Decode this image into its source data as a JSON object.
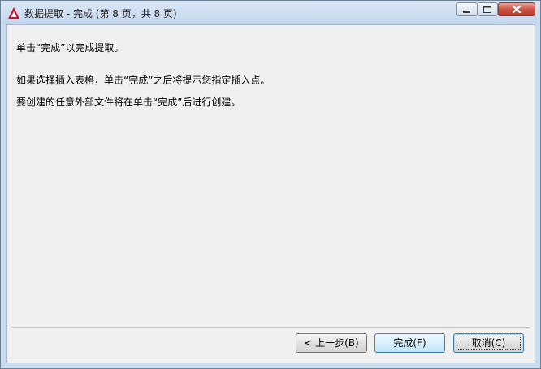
{
  "window": {
    "title": "数据提取 - 完成 (第 8 页，共 8 页)"
  },
  "content": {
    "line1": "单击“完成”以完成提取。",
    "line2": "如果选择插入表格，单击“完成”之后将提示您指定插入点。",
    "line3": "要创建的任意外部文件将在单击“完成”后进行创建。"
  },
  "buttons": {
    "back": "< 上一步(B)",
    "finish": "完成(F)",
    "cancel": "取消(C)"
  },
  "icons": {
    "app": "autocad-logo-icon",
    "minimize": "minimize-icon",
    "maximize": "maximize-icon",
    "close": "close-icon"
  },
  "colors": {
    "app_icon": "#c8102e",
    "close_button": "#c8513f"
  }
}
